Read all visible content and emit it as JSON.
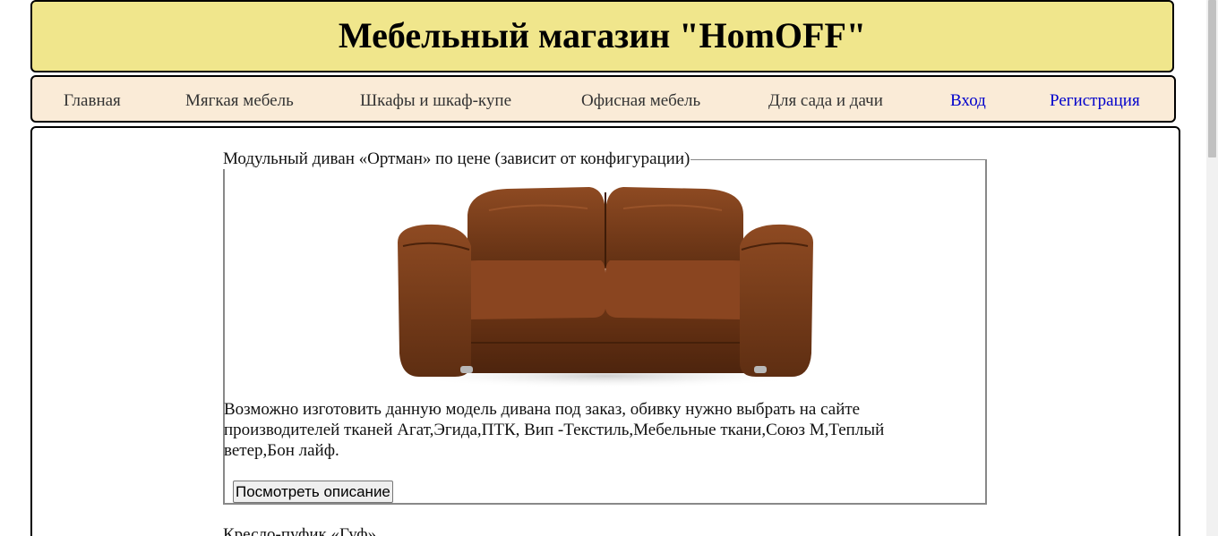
{
  "header": {
    "title": "Мебельный магазин \"HomOFF\""
  },
  "nav": {
    "items": [
      {
        "label": "Главная"
      },
      {
        "label": "Мягкая мебель"
      },
      {
        "label": "Шкафы и шкаф-купе"
      },
      {
        "label": "Офисная мебель"
      },
      {
        "label": "Для сада и дачи"
      },
      {
        "label": "Вход"
      },
      {
        "label": "Регистрация"
      }
    ]
  },
  "product": {
    "title": "Модульный диван «Ортман» по цене (зависит от конфигурации)",
    "image_icon": "sofa-image",
    "description": "Возможно изготовить данную модель дивана под заказ, обивку нужно выбрать на сайте производителей тканей Агат,Эгида,ПТК, Вип -Текстиль,Мебельные ткани,Союз М,Теплый ветер,Бон лайф.",
    "button_label": "Посмотреть описание"
  },
  "next_product": {
    "title": "Кресло-пуфик «Гуф»"
  },
  "colors": {
    "header_bg": "#f0e68c",
    "nav_bg": "#faebd7",
    "link_blue": "#0000cc",
    "sofa_brown": "#7a3e1c"
  }
}
